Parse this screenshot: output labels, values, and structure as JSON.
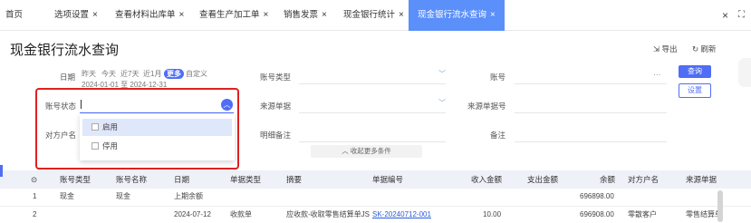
{
  "tabs": [
    {
      "label": "首页",
      "close": ""
    },
    {
      "label": "选项设置",
      "close": "×"
    },
    {
      "label": "查看材料出库单",
      "close": "×"
    },
    {
      "label": "查看生产加工单",
      "close": "×"
    },
    {
      "label": "销售发票",
      "close": "×"
    },
    {
      "label": "现金银行统计",
      "close": "×"
    },
    {
      "label": "现金银行流水查询",
      "close": "×"
    }
  ],
  "window": {
    "close": "×",
    "restore": "⛶"
  },
  "page": {
    "title": "现金银行流水查询",
    "export": "导出",
    "refresh": "刷新"
  },
  "filters": {
    "date_label": "日期",
    "date_options": [
      "昨天",
      "今天",
      "近7天",
      "近1月",
      "更多",
      "自定义"
    ],
    "date_range": "2024-01-01 至 2024-12-31",
    "account_status_label": "账号状态",
    "counterparty_label": "对方户名",
    "account_type_label": "账号类型",
    "source_doc_label": "来源单据",
    "detail_note_label": "明细备注",
    "account_no_label": "账号",
    "source_doc_no_label": "来源单据号",
    "note_label": "备注",
    "more_dots": "···",
    "collapse": "收起更多条件",
    "query_button": "查询",
    "settings_button": "设置"
  },
  "status_dropdown": {
    "options": [
      "启用",
      "停用"
    ]
  },
  "table": {
    "headers": [
      "账号类型",
      "账号名称",
      "日期",
      "单据类型",
      "摘要",
      "单据编号",
      "收入金额",
      "支出金额",
      "余额",
      "对方户名",
      "来源单据"
    ],
    "rows": [
      {
        "idx": "1",
        "type": "现金",
        "name": "现金",
        "date": "上期余额",
        "doc_type": "",
        "summary": "",
        "doc_no": "",
        "income": "",
        "expense": "",
        "balance": "696898.00",
        "counterparty": "",
        "source": ""
      },
      {
        "idx": "2",
        "type": "",
        "name": "",
        "date": "2024-07-12",
        "doc_type": "收款单",
        "summary": "应收款-收取零售结算单JS",
        "doc_no": "SK-20240712-001",
        "income": "10.00",
        "expense": "",
        "balance": "696908.00",
        "counterparty": "零散客户",
        "source": "零售结算单"
      }
    ]
  }
}
